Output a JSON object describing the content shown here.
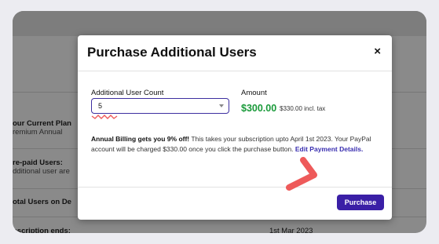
{
  "background": {
    "rows": [
      {
        "title": "our Current Plan",
        "sub": "remium Annual"
      },
      {
        "title": "re-paid Users:",
        "sub": "dditional user are"
      },
      {
        "title": "otal Users on De",
        "sub": ""
      },
      {
        "title": "bscription ends:",
        "sub": ""
      }
    ],
    "date": "1st Mar 2023"
  },
  "modal": {
    "title": "Purchase Additional Users",
    "close_glyph": "×",
    "count_label": "Additional User Count",
    "count_value": "5",
    "amount_label": "Amount",
    "amount_value": "$300.00",
    "amount_tax": "$330.00 incl. tax",
    "info_strong": "Annual Billing gets you 9% off!",
    "info_text": " This takes your subscription upto April 1st 2023. Your PayPal account will be charged $330.00 once you click the purchase button. ",
    "info_link": "Edit Payment Details.",
    "purchase_label": "Purchase"
  },
  "colors": {
    "accent": "#3a1fa6",
    "amount_green": "#1a9a3a",
    "annotation": "#ee5a5a"
  }
}
